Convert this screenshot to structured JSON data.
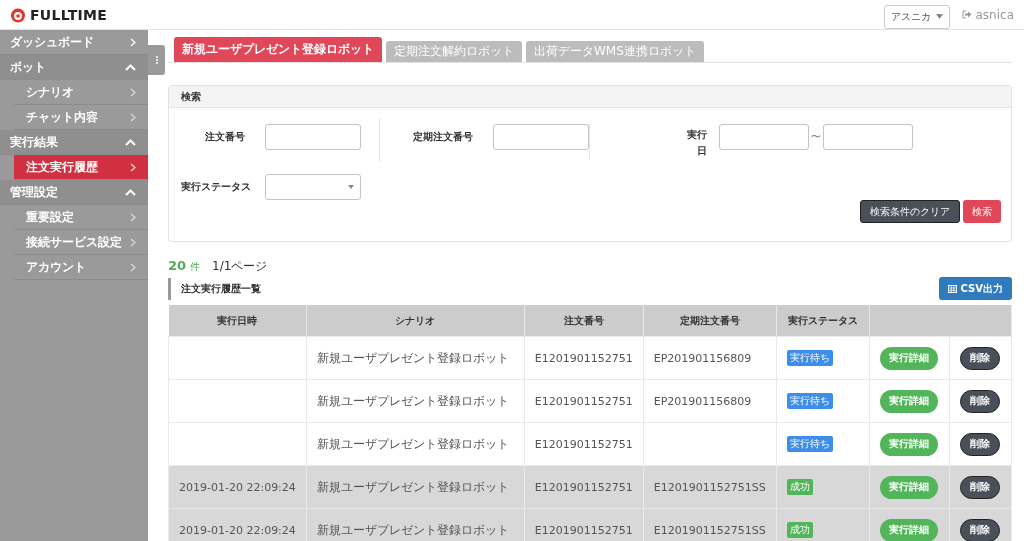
{
  "header": {
    "logo": "FULLTIME",
    "user_menu": "アスニカ",
    "logout": "asnica"
  },
  "sidebar": {
    "items": [
      {
        "label": "ダッシュボード",
        "expanded": false
      },
      {
        "label": "ボット",
        "expanded": true,
        "children": [
          {
            "label": "シナリオ",
            "selected": false
          },
          {
            "label": "チャット内容",
            "selected": false
          }
        ]
      },
      {
        "label": "実行結果",
        "expanded": true,
        "children": [
          {
            "label": "注文実行履歴",
            "selected": true
          }
        ]
      },
      {
        "label": "管理設定",
        "expanded": true,
        "children": [
          {
            "label": "重要設定",
            "selected": false
          },
          {
            "label": "接続サービス設定",
            "selected": false
          },
          {
            "label": "アカウント",
            "selected": false
          }
        ]
      }
    ]
  },
  "tabs": [
    {
      "label": "新規ユーザプレゼント登録ロボット",
      "selected": true
    },
    {
      "label": "定期注文解約ロボット",
      "selected": false
    },
    {
      "label": "出荷データWMS連携ロボット",
      "selected": false
    }
  ],
  "search": {
    "title": "検索",
    "order_number": {
      "label": "注文番号"
    },
    "subscription_number": {
      "label": "定期注文番号"
    },
    "date": {
      "label_line1": "実行",
      "label_line2": "日",
      "separator": "〜"
    },
    "status": {
      "label": "実行ステータス"
    },
    "clear_button": "検索条件のクリア",
    "search_button": "検索"
  },
  "summary": {
    "count": "20",
    "count_unit": "件",
    "pages": "1/1ページ"
  },
  "list_title": "注文実行履歴一覧",
  "csv_button": "CSV出力",
  "table": {
    "columns": [
      "実行日時",
      "シナリオ",
      "注文番号",
      "定期注文番号",
      "実行ステータス"
    ],
    "rows": [
      {
        "datetime": "",
        "scenario": "新規ユーザプレゼント登録ロボット",
        "order": "E1201901152751",
        "subscription": "EP201901156809",
        "status": {
          "label": "実行待ち",
          "kind": "waiting"
        },
        "detail": "実行詳細",
        "delete": "削除"
      },
      {
        "datetime": "",
        "scenario": "新規ユーザプレゼント登録ロボット",
        "order": "E1201901152751",
        "subscription": "EP201901156809",
        "status": {
          "label": "実行待ち",
          "kind": "waiting"
        },
        "detail": "実行詳細",
        "delete": "削除"
      },
      {
        "datetime": "",
        "scenario": "新規ユーザプレゼント登録ロボット",
        "order": "E1201901152751",
        "subscription": "",
        "status": {
          "label": "実行待ち",
          "kind": "waiting"
        },
        "detail": "実行詳細",
        "delete": "削除"
      },
      {
        "datetime": "2019-01-20 22:09:24",
        "scenario": "新規ユーザプレゼント登録ロボット",
        "order": "E1201901152751",
        "subscription": "E1201901152751SS",
        "status": {
          "label": "成功",
          "kind": "success"
        },
        "detail": "実行詳細",
        "delete": "削除"
      },
      {
        "datetime": "2019-01-20 22:09:24",
        "scenario": "新規ユーザプレゼント登録ロボット",
        "order": "E1201901152751",
        "subscription": "E1201901152751SS",
        "status": {
          "label": "成功",
          "kind": "success"
        },
        "detail": "実行詳細",
        "delete": "削除"
      }
    ]
  }
}
